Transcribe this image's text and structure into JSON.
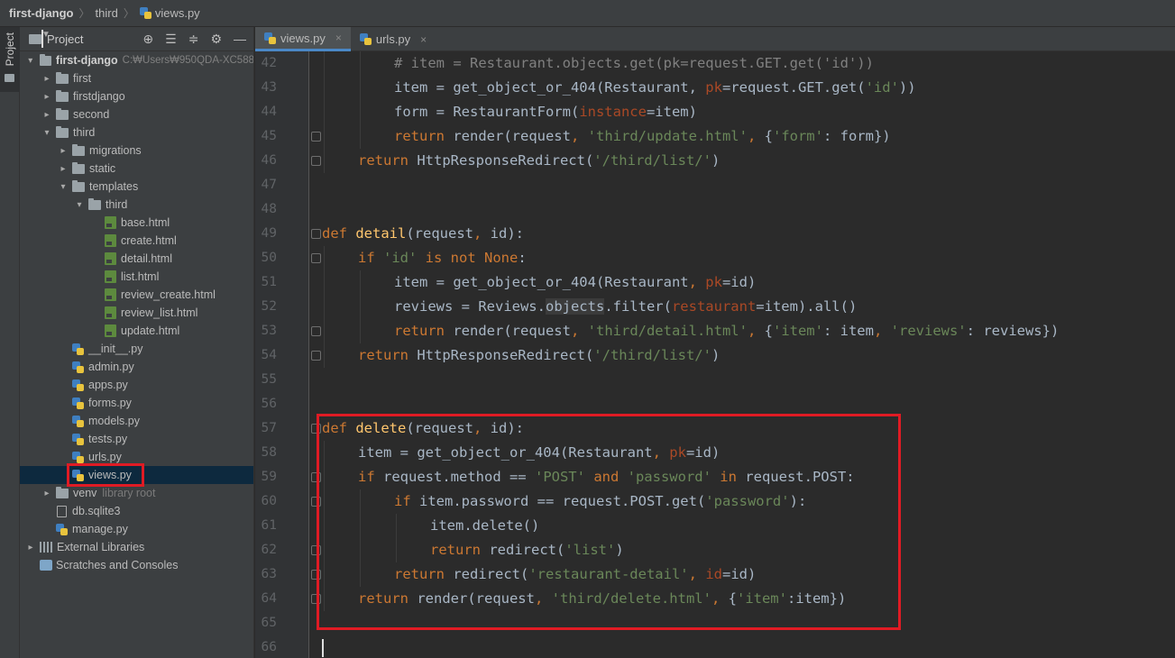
{
  "breadcrumb": {
    "project": "first-django",
    "folder": "third",
    "file": "views.py"
  },
  "tool_window": {
    "vertical_tab_label": "Project",
    "header_title": "Project",
    "tool_icons": [
      "crosshair-icon",
      "expand-all-icon",
      "collapse-all-icon",
      "gear-icon",
      "minimize-icon"
    ]
  },
  "tree": [
    {
      "label": "first-django",
      "hint": "C:₩Users₩950QDA-XC588",
      "kind": "folder",
      "depth": 0,
      "arrow": "open",
      "bold": true
    },
    {
      "label": "first",
      "kind": "folder",
      "depth": 1,
      "arrow": "closed"
    },
    {
      "label": "firstdjango",
      "kind": "folder",
      "depth": 1,
      "arrow": "closed"
    },
    {
      "label": "second",
      "kind": "folder",
      "depth": 1,
      "arrow": "closed"
    },
    {
      "label": "third",
      "kind": "folder",
      "depth": 1,
      "arrow": "open"
    },
    {
      "label": "migrations",
      "kind": "folder",
      "depth": 2,
      "arrow": "closed"
    },
    {
      "label": "static",
      "kind": "folder",
      "depth": 2,
      "arrow": "closed"
    },
    {
      "label": "templates",
      "kind": "folder",
      "depth": 2,
      "arrow": "open"
    },
    {
      "label": "third",
      "kind": "folder",
      "depth": 3,
      "arrow": "open"
    },
    {
      "label": "base.html",
      "kind": "html",
      "depth": 4
    },
    {
      "label": "create.html",
      "kind": "html",
      "depth": 4
    },
    {
      "label": "detail.html",
      "kind": "html",
      "depth": 4
    },
    {
      "label": "list.html",
      "kind": "html",
      "depth": 4
    },
    {
      "label": "review_create.html",
      "kind": "html",
      "depth": 4
    },
    {
      "label": "review_list.html",
      "kind": "html",
      "depth": 4
    },
    {
      "label": "update.html",
      "kind": "html",
      "depth": 4
    },
    {
      "label": "__init__.py",
      "kind": "py",
      "depth": 2
    },
    {
      "label": "admin.py",
      "kind": "py",
      "depth": 2
    },
    {
      "label": "apps.py",
      "kind": "py",
      "depth": 2
    },
    {
      "label": "forms.py",
      "kind": "py",
      "depth": 2
    },
    {
      "label": "models.py",
      "kind": "py",
      "depth": 2
    },
    {
      "label": "tests.py",
      "kind": "py",
      "depth": 2
    },
    {
      "label": "urls.py",
      "kind": "py",
      "depth": 2
    },
    {
      "label": "views.py",
      "kind": "py",
      "depth": 2,
      "selected": true,
      "highlighted": true
    },
    {
      "label": "venv",
      "hint": "library root",
      "kind": "folder",
      "depth": 1,
      "arrow": "closed"
    },
    {
      "label": "db.sqlite3",
      "kind": "db",
      "depth": 1
    },
    {
      "label": "manage.py",
      "kind": "py",
      "depth": 1
    },
    {
      "label": "External Libraries",
      "kind": "lib",
      "depth": 0,
      "arrow": "closed"
    },
    {
      "label": "Scratches and Consoles",
      "kind": "scratch",
      "depth": 0
    }
  ],
  "tabs": [
    {
      "label": "views.py",
      "active": true,
      "close": "×"
    },
    {
      "label": "urls.py",
      "active": false,
      "close": "×"
    }
  ],
  "code": [
    {
      "n": "42",
      "indent": 2,
      "tokens": [
        [
          "cmt",
          "# item = Restaurant.objects.get(pk=request.GET.get('id'))"
        ]
      ]
    },
    {
      "n": "43",
      "indent": 2,
      "tokens": [
        [
          "",
          "item = get_object_or_404(Restaurant, "
        ],
        [
          "prm",
          "pk"
        ],
        [
          "",
          "=request.GET.get("
        ],
        [
          "str",
          "'id'"
        ],
        [
          "",
          "))"
        ]
      ]
    },
    {
      "n": "44",
      "indent": 2,
      "tokens": [
        [
          "",
          "form = RestaurantForm("
        ],
        [
          "prm",
          "instance"
        ],
        [
          "",
          "=item)"
        ]
      ]
    },
    {
      "n": "45",
      "indent": 2,
      "tokens": [
        [
          "kw",
          "return "
        ],
        [
          "",
          "render(request"
        ],
        [
          "kw",
          ", "
        ],
        [
          "str",
          "'third/update.html'"
        ],
        [
          "kw",
          ", "
        ],
        [
          "",
          "{"
        ],
        [
          "str",
          "'form'"
        ],
        [
          "",
          ": form})"
        ]
      ],
      "fold": true
    },
    {
      "n": "46",
      "indent": 1,
      "tokens": [
        [
          "kw",
          "return "
        ],
        [
          "",
          "HttpResponseRedirect("
        ],
        [
          "str",
          "'/third/list/'"
        ],
        [
          "",
          ")"
        ]
      ],
      "fold": true
    },
    {
      "n": "47",
      "indent": 0,
      "tokens": []
    },
    {
      "n": "48",
      "indent": 0,
      "tokens": []
    },
    {
      "n": "49",
      "indent": 0,
      "tokens": [
        [
          "kw",
          "def "
        ],
        [
          "fn",
          "detail"
        ],
        [
          "",
          "(request"
        ],
        [
          "kw",
          ", "
        ],
        [
          "",
          "id):"
        ]
      ],
      "fold": true
    },
    {
      "n": "50",
      "indent": 1,
      "tokens": [
        [
          "kw",
          "if "
        ],
        [
          "str",
          "'id'"
        ],
        [
          "kw",
          " is not None"
        ],
        [
          "",
          ":"
        ]
      ],
      "fold": true
    },
    {
      "n": "51",
      "indent": 2,
      "tokens": [
        [
          "",
          "item = get_object_or_404(Restaurant"
        ],
        [
          "kw",
          ", "
        ],
        [
          "prm",
          "pk"
        ],
        [
          "",
          "=id)"
        ]
      ]
    },
    {
      "n": "52",
      "indent": 2,
      "tokens": [
        [
          "",
          "reviews = Reviews."
        ],
        [
          "hl",
          "objects"
        ],
        [
          "",
          ".filter("
        ],
        [
          "prm",
          "restaurant"
        ],
        [
          "",
          "=item).all()"
        ]
      ]
    },
    {
      "n": "53",
      "indent": 2,
      "tokens": [
        [
          "kw",
          "return "
        ],
        [
          "",
          "render(request"
        ],
        [
          "kw",
          ", "
        ],
        [
          "str",
          "'third/detail.html'"
        ],
        [
          "kw",
          ", "
        ],
        [
          "",
          "{"
        ],
        [
          "str",
          "'item'"
        ],
        [
          "",
          ": item"
        ],
        [
          "kw",
          ", "
        ],
        [
          "str",
          "'reviews'"
        ],
        [
          "",
          ": reviews})"
        ]
      ],
      "fold": true
    },
    {
      "n": "54",
      "indent": 1,
      "tokens": [
        [
          "kw",
          "return "
        ],
        [
          "",
          "HttpResponseRedirect("
        ],
        [
          "str",
          "'/third/list/'"
        ],
        [
          "",
          ")"
        ]
      ],
      "fold": true
    },
    {
      "n": "55",
      "indent": 0,
      "tokens": []
    },
    {
      "n": "56",
      "indent": 0,
      "tokens": []
    },
    {
      "n": "57",
      "indent": 0,
      "tokens": [
        [
          "kw",
          "def "
        ],
        [
          "fn",
          "delete"
        ],
        [
          "",
          "(request"
        ],
        [
          "kw",
          ", "
        ],
        [
          "",
          "id):"
        ]
      ],
      "fold": true
    },
    {
      "n": "58",
      "indent": 1,
      "tokens": [
        [
          "",
          "item = get_object_or_404(Restaurant"
        ],
        [
          "kw",
          ", "
        ],
        [
          "prm",
          "pk"
        ],
        [
          "",
          "=id)"
        ]
      ]
    },
    {
      "n": "59",
      "indent": 1,
      "tokens": [
        [
          "kw",
          "if "
        ],
        [
          "",
          "request.method == "
        ],
        [
          "str",
          "'POST' "
        ],
        [
          "kw",
          "and "
        ],
        [
          "str",
          "'password' "
        ],
        [
          "kw",
          "in "
        ],
        [
          "",
          "request.POST:"
        ]
      ],
      "fold": true
    },
    {
      "n": "60",
      "indent": 2,
      "tokens": [
        [
          "kw",
          "if "
        ],
        [
          "",
          "item.password == request.POST.get("
        ],
        [
          "str",
          "'password'"
        ],
        [
          "",
          "):"
        ]
      ],
      "fold": true
    },
    {
      "n": "61",
      "indent": 3,
      "tokens": [
        [
          "",
          "item.delete()"
        ]
      ]
    },
    {
      "n": "62",
      "indent": 3,
      "tokens": [
        [
          "kw",
          "return "
        ],
        [
          "",
          "redirect("
        ],
        [
          "str",
          "'list'"
        ],
        [
          "",
          ")"
        ]
      ],
      "fold": true
    },
    {
      "n": "63",
      "indent": 2,
      "tokens": [
        [
          "kw",
          "return "
        ],
        [
          "",
          "redirect("
        ],
        [
          "str",
          "'restaurant-detail'"
        ],
        [
          "kw",
          ", "
        ],
        [
          "prm",
          "id"
        ],
        [
          "",
          "=id)"
        ]
      ],
      "fold": true
    },
    {
      "n": "64",
      "indent": 1,
      "tokens": [
        [
          "kw",
          "return "
        ],
        [
          "",
          "render(request"
        ],
        [
          "kw",
          ", "
        ],
        [
          "str",
          "'third/delete.html'"
        ],
        [
          "kw",
          ", "
        ],
        [
          "",
          "{"
        ],
        [
          "str",
          "'item'"
        ],
        [
          "",
          ":item})"
        ]
      ],
      "fold": true
    },
    {
      "n": "65",
      "indent": 0,
      "tokens": []
    },
    {
      "n": "66",
      "indent": 0,
      "tokens": [],
      "caret": true
    }
  ],
  "colors": {
    "highlight_box": "#e01b24",
    "selection": "#0d293e",
    "keyword": "#cc7832",
    "function": "#ffc66d",
    "string": "#6a8759",
    "param": "#aa4926",
    "comment": "#808080"
  }
}
